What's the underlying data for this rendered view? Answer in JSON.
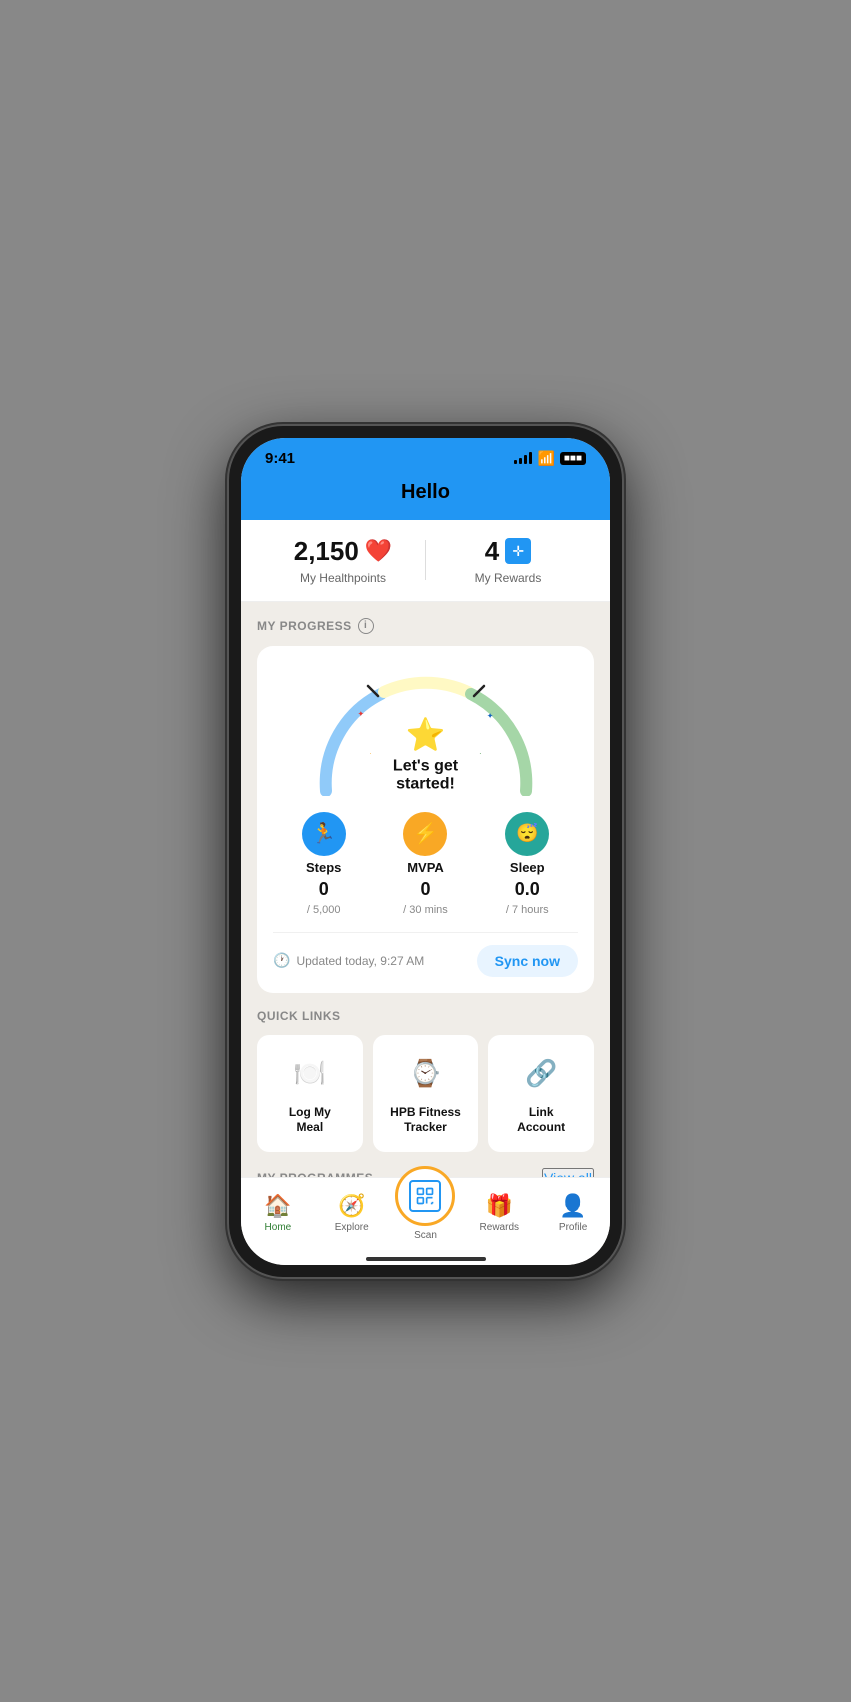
{
  "status": {
    "time": "9:41"
  },
  "header": {
    "greeting": "Hello"
  },
  "stats": {
    "healthpoints_value": "2,150",
    "healthpoints_label": "My Healthpoints",
    "rewards_value": "4",
    "rewards_label": "My Rewards"
  },
  "progress": {
    "section_title": "MY PROGRESS",
    "gauge_text": "Let's get started!",
    "metrics": [
      {
        "name": "Steps",
        "value": "0",
        "max": "/ 5,000",
        "color": "blue",
        "icon": "👟"
      },
      {
        "name": "MVPA",
        "value": "0",
        "max": "/ 30 mins",
        "color": "yellow",
        "icon": "⚡"
      },
      {
        "name": "Sleep",
        "value": "0.0",
        "max": "/ 7 hours",
        "color": "green",
        "icon": "😴"
      }
    ],
    "updated_text": "Updated today, 9:27 AM",
    "sync_label": "Sync now"
  },
  "quick_links": {
    "section_title": "QUICK LINKS",
    "items": [
      {
        "label": "Log My\nMeal",
        "icon": "🍽️",
        "id": "log-meal"
      },
      {
        "label": "HPB Fitness\nTracker",
        "icon": "⌚",
        "id": "fitness-tracker"
      },
      {
        "label": "Link\nAccount",
        "icon": "🔗",
        "id": "link-account"
      }
    ]
  },
  "programmes": {
    "section_title": "MY PROGRAMMES",
    "view_all": "View all"
  },
  "nav": {
    "items": [
      {
        "id": "home",
        "label": "Home",
        "icon": "🏠",
        "active": true
      },
      {
        "id": "explore",
        "label": "Explore",
        "icon": "🧭",
        "active": false
      },
      {
        "id": "scan",
        "label": "Scan",
        "icon": "📷",
        "active": false,
        "is_scan": true
      },
      {
        "id": "rewards",
        "label": "Rewards",
        "icon": "🎁",
        "active": false
      },
      {
        "id": "profile",
        "label": "Profile",
        "icon": "👤",
        "active": false
      }
    ]
  }
}
